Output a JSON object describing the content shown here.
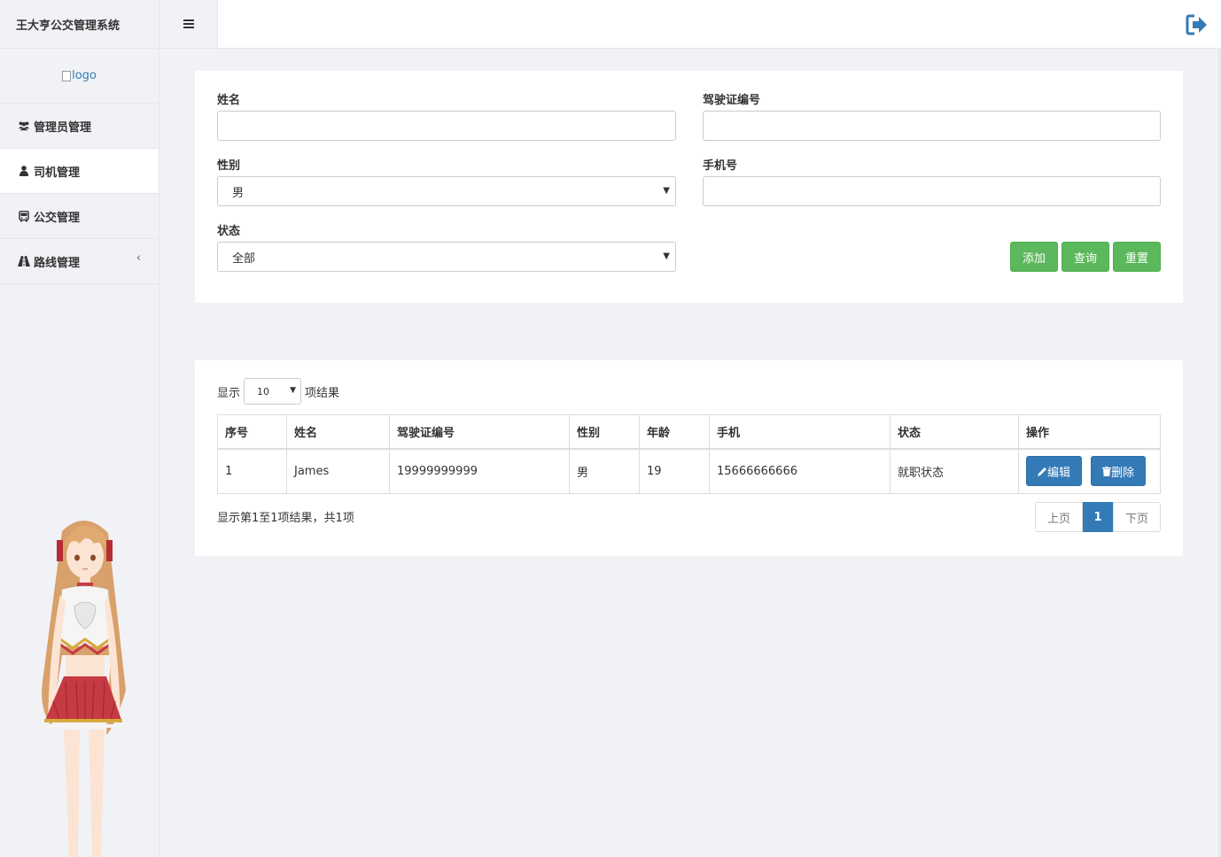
{
  "app": {
    "title": "王大亨公交管理系统",
    "logo_alt": "logo"
  },
  "sidebar": {
    "items": [
      {
        "label": "管理员管理",
        "icon": "users-icon"
      },
      {
        "label": "司机管理",
        "icon": "user-icon"
      },
      {
        "label": "公交管理",
        "icon": "bus-icon"
      },
      {
        "label": "路线管理",
        "icon": "road-icon"
      }
    ]
  },
  "form": {
    "name_label": "姓名",
    "name_value": "",
    "license_label": "驾驶证编号",
    "license_value": "",
    "gender_label": "性别",
    "gender_value": "男",
    "phone_label": "手机号",
    "phone_value": "",
    "status_label": "状态",
    "status_value": "全部",
    "add_label": "添加",
    "search_label": "查询",
    "reset_label": "重置"
  },
  "table": {
    "length_prefix": "显示",
    "length_value": "10",
    "length_suffix": "项结果",
    "headers": [
      "序号",
      "姓名",
      "驾驶证编号",
      "性别",
      "年龄",
      "手机",
      "状态",
      "操作"
    ],
    "rows": [
      {
        "id": "1",
        "name": "James",
        "license": "19999999999",
        "gender": "男",
        "age": "19",
        "phone": "15666666666",
        "status": "就职状态",
        "edit_label": "编辑",
        "delete_label": "删除"
      }
    ],
    "info": "显示第1至1项结果，共1项",
    "prev_label": "上页",
    "current_page": "1",
    "next_label": "下页"
  },
  "colors": {
    "primary": "#337ab7",
    "success": "#5cb85c",
    "background": "#f1f2f6"
  }
}
